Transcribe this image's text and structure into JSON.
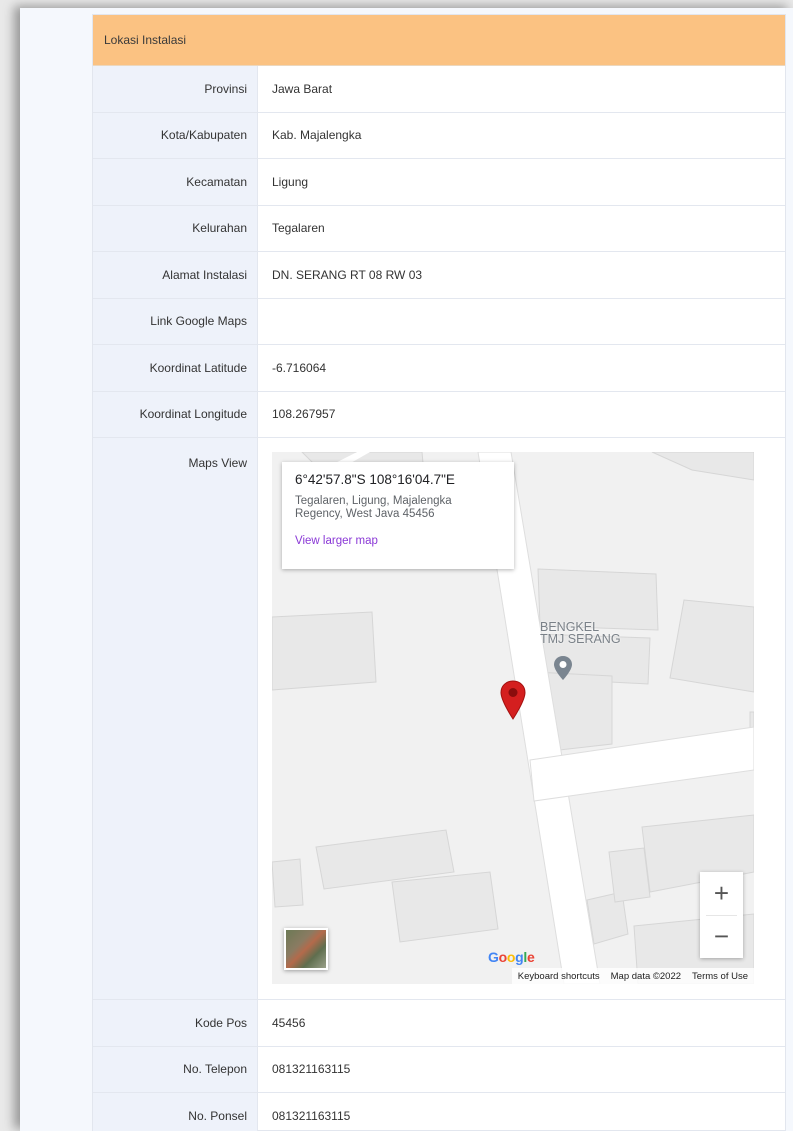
{
  "section_title": "Lokasi Instalasi",
  "rows": {
    "provinsi": {
      "label": "Provinsi",
      "value": "Jawa Barat"
    },
    "kota": {
      "label": "Kota/Kabupaten",
      "value": "Kab. Majalengka"
    },
    "kecamatan": {
      "label": "Kecamatan",
      "value": "Ligung"
    },
    "kelurahan": {
      "label": "Kelurahan",
      "value": "Tegalaren"
    },
    "alamat": {
      "label": "Alamat Instalasi",
      "value": "DN. SERANG RT 08 RW 03"
    },
    "link_maps": {
      "label": "Link Google Maps",
      "value": ""
    },
    "latitude": {
      "label": "Koordinat Latitude",
      "value": "-6.716064"
    },
    "longitude": {
      "label": "Koordinat Longitude",
      "value": "108.267957"
    },
    "maps_view": {
      "label": "Maps View"
    },
    "kode_pos": {
      "label": "Kode Pos",
      "value": "45456"
    },
    "telepon": {
      "label": "No. Telepon",
      "value": "081321163115"
    },
    "ponsel": {
      "label": "No. Ponsel",
      "value": "081321163115"
    }
  },
  "map": {
    "coords_title": "6°42'57.8\"S 108°16'04.7\"E",
    "address": "Tegalaren, Ligung, Majalengka Regency, West Java 45456",
    "view_larger": "View larger map",
    "poi_line1": "BENGKEL",
    "poi_line2": "TMJ SERANG",
    "zoom_in": "+",
    "zoom_out": "−",
    "footer": {
      "shortcuts": "Keyboard shortcuts",
      "map_data": "Map data ©2022",
      "terms": "Terms of Use"
    },
    "logo_letters": [
      "G",
      "o",
      "o",
      "g",
      "l",
      "e"
    ],
    "logo_colors": [
      "#4285F4",
      "#EA4335",
      "#FBBC05",
      "#4285F4",
      "#34A853",
      "#EA4335"
    ]
  },
  "colors": {
    "header_bg": "#fbc282",
    "label_bg": "#eef2fa",
    "pin": "#d41f1f"
  }
}
